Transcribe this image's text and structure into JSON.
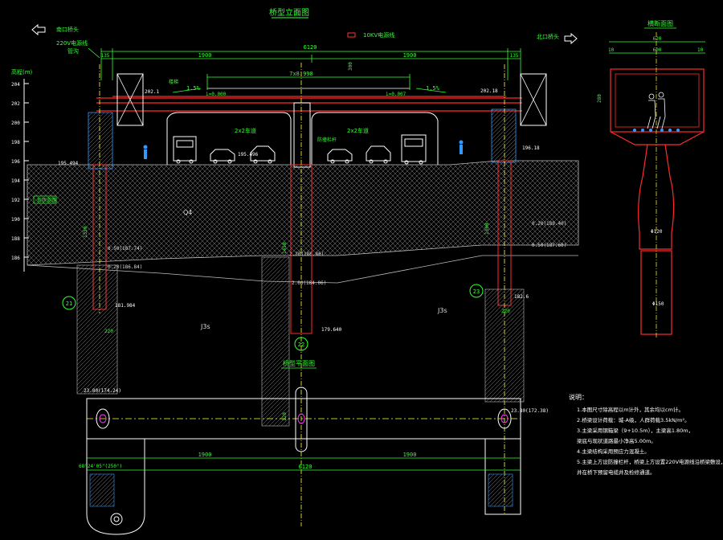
{
  "colors": {
    "background": "#000000",
    "structure": "#ff2a2a",
    "dimension": "#33ff33",
    "annotation": "#ffffff",
    "hatch": "#bdbdbd",
    "axis": "#ffff33",
    "cable_mark": "#ff3333",
    "accent": "#3399ff",
    "magenta": "#ff33ff"
  },
  "elevation_view": {
    "title": "桥型立面图",
    "left_arrow_label": "南口桥头",
    "right_arrow_label": "北口桥头",
    "cable_220kv": "220V电源线",
    "cable_220kv_sub": "管沟",
    "cable_10kv": "10KV电源线",
    "elev_scale_title": "高程(m)",
    "elev_ticks": [
      "204",
      "202",
      "200",
      "198",
      "196",
      "194",
      "192",
      "190",
      "188",
      "186"
    ],
    "dim_total": "6120",
    "dim_left_main": "1900",
    "dim_right_main": "1900",
    "dim_left_end": "135",
    "dim_right_end": "135",
    "dim_center": "7x8.998",
    "dim_height": "300",
    "slope_left": "1.5%",
    "slope_right": "1.5%",
    "lane_left": "2x2车道",
    "lane_right": "2x2车道",
    "grade_left": "i=0.000",
    "grade_right": "i=0.007",
    "handrail_label": "防撞栏杆",
    "road_label_left": "现状道路",
    "stair_label": "楼梯",
    "elev_left_deck": "202.1",
    "elev_right_deck": "202.18",
    "elev_left_ground": "195.494",
    "elev_right_ground": "196.18",
    "elev_center": "195.496",
    "elev_pile_left": "181.984",
    "elev_pile_center": "179.640",
    "elev_pile_right": "182.6",
    "soil_upper": "Q4",
    "soil_lower_left": "J3s",
    "soil_lower_right": "J3s",
    "layer_left_1": "0.50(187.74)",
    "layer_left_2": "0.20(186.84)",
    "layer_center_1": "2.20(186.86)",
    "layer_center_2": "2.00(184.06)",
    "layer_right_1": "0.20(189.40)",
    "layer_right_2": "0.50(187.60)",
    "pile_len_left": "1350",
    "pile_len_center": "1450",
    "pile_len_right": "1300",
    "pier_left_id": "21",
    "pier_center_id": "22",
    "pier_right_id": "23",
    "dim_left_pier": "220",
    "dim_right_pier": "220",
    "elev_plan_left": "23.80(174.24)",
    "elev_plan_right": "23.80(172.38)",
    "dim_plan_height": "120"
  },
  "plan_view": {
    "title": "桥型平面图",
    "dim_left": "1900",
    "dim_right": "1900",
    "dim_total": "6120",
    "angle_note": "68°24'05\"(250°)"
  },
  "section_view": {
    "title": "横断面图",
    "dim_top": "620",
    "dim_inner": "600",
    "dim_edge_left": "10",
    "dim_edge_right": "10",
    "dim_height": "280",
    "dim_pile": "Φ150",
    "dim_pier": "Φ120"
  },
  "notes": {
    "heading": "说明：",
    "lines": [
      "1.本图尺寸除高程以m计外，其余均以cm计。",
      "2.桥梁设计荷载：城-A级，人群荷载3.5kN/m²。",
      "3.主梁采用钢箱梁（9+10.5m），主梁高1.80m，",
      "   梁底与现状道路最小净高5.00m。",
      "4.主梁结构采用预应力混凝土。",
      "5.主梁上方设防撞栏杆，桥梁上方设置220V电源线沿桥梁敷设，",
      "   并在桥下预留电缆井及检修通道。"
    ]
  }
}
